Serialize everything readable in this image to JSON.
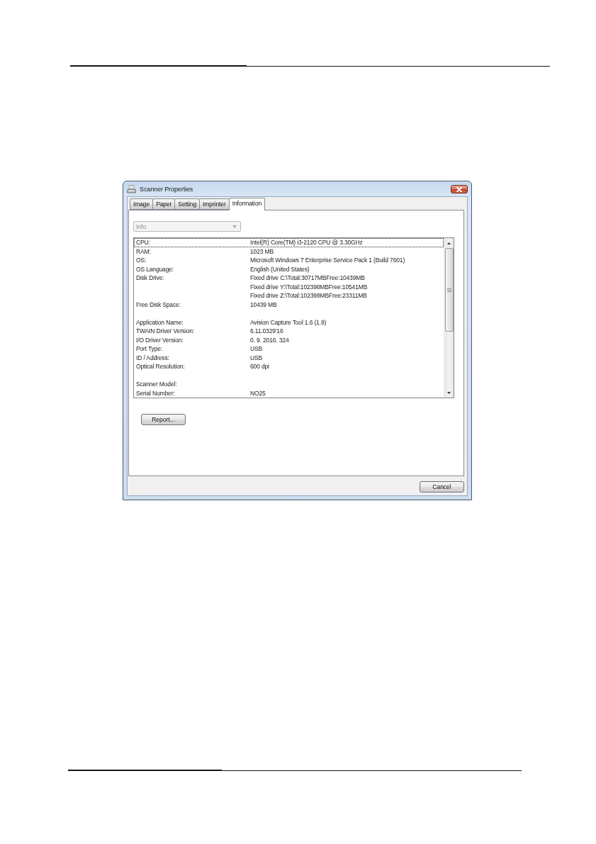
{
  "window": {
    "title": "Scanner Properties"
  },
  "tabs": [
    {
      "label": "Image",
      "selected": false
    },
    {
      "label": "Paper",
      "selected": false
    },
    {
      "label": "Setting",
      "selected": false
    },
    {
      "label": "Imprinter",
      "selected": false
    },
    {
      "label": "Information",
      "selected": true
    }
  ],
  "info_select": {
    "value": "Info",
    "disabled": true
  },
  "info_list": {
    "groups": [
      {
        "rows": [
          {
            "label": "CPU:",
            "value": "Intel(R) Core(TM) i3-2120 CPU @ 3.30GHz",
            "focused": true
          },
          {
            "label": "RAM:",
            "value": "1023 MB",
            "focused": false
          },
          {
            "label": "OS:",
            "value": "Microsoft Windows 7 Enterprise Service Pack 1 (Build 7601)",
            "focused": false
          },
          {
            "label": "OS Language:",
            "value": "English (United States)",
            "focused": false
          },
          {
            "label": "Disk Drive:",
            "value": "Fixed drive C:\\Total:30717MBFree:10439MB",
            "focused": false
          },
          {
            "value": "Fixed drive Y:\\Total:102398MBFree:10541MB",
            "focused": false
          },
          {
            "value": "Fixed drive Z:\\Total:102398MBFree:23311MB",
            "focused": false
          },
          {
            "label": "Free Disk Space:",
            "value": "10439 MB",
            "focused": false
          }
        ]
      },
      {
        "rows": [
          {
            "label": "Application Name:",
            "value": "Avision Capture Tool 1.6 (1.9)",
            "focused": false
          },
          {
            "label": "TWAIN Driver Version:",
            "value": "6.11.0329'16",
            "focused": false
          },
          {
            "label": "I/O Driver Version:",
            "value": "0. 9. 2016. 324",
            "focused": false
          },
          {
            "label": "Port Type:",
            "value": "USB",
            "focused": false
          },
          {
            "label": "ID / Address:",
            "value": "USB",
            "focused": false
          },
          {
            "label": "Optical Resolution:",
            "value": "600 dpi",
            "focused": false
          }
        ]
      },
      {
        "rows": [
          {
            "label": "Scanner Model:",
            "focused": false
          },
          {
            "label": "Serial Number:",
            "value": "NO25",
            "focused": false
          }
        ]
      }
    ]
  },
  "report_button": {
    "label": "Report..."
  },
  "footer_buttons": [
    {
      "label": "Cancel"
    }
  ]
}
